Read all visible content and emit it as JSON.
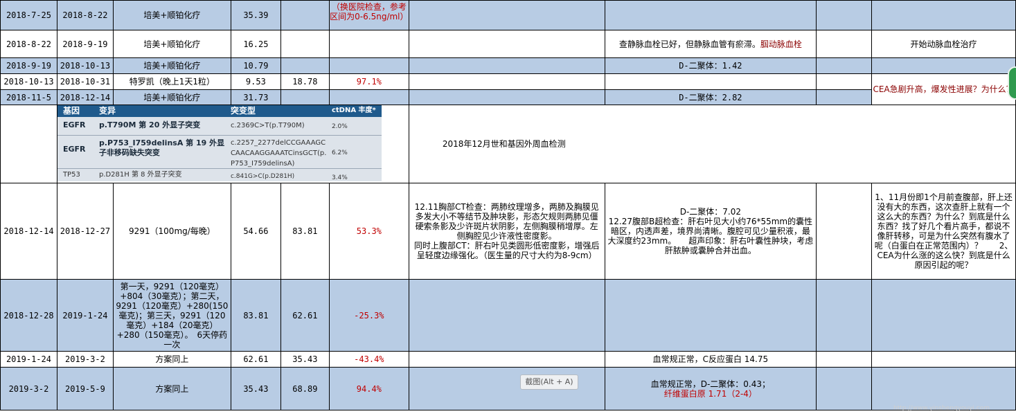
{
  "rows": [
    {
      "start": "2018-7-25",
      "end": "2018-8-22",
      "plan": "培美+顺铂化疗",
      "cea_before": "35.39",
      "cea_after": "",
      "change": "（换医院检查，参考区间为0-6.5ng/ml）",
      "ct": "",
      "other": "",
      "notes": ""
    },
    {
      "start": "2018-8-22",
      "end": "2018-9-19",
      "plan": "培美+顺铂化疗",
      "cea_before": "16.25",
      "cea_after": "",
      "change": "",
      "ct": "",
      "other_plain": "查静脉血栓已好，但静脉血管有瘀滞。",
      "other_red": "腘动脉血栓",
      "notes": "开始动脉血栓治疗"
    },
    {
      "start": "2018-9-19",
      "end": "2018-10-13",
      "plan": "培美+顺铂化疗",
      "cea_before": "10.79",
      "cea_after": "",
      "change": "",
      "ct": "",
      "other": "D-二聚体：1.42",
      "notes": ""
    },
    {
      "start": "2018-10-13",
      "end": "2018-10-31",
      "plan": "特罗凯（晚上1天1粒）",
      "cea_before": "9.53",
      "cea_after": "18.78",
      "change": "97.1%",
      "ct": "",
      "other": "",
      "notes": "CEA急剧升高，爆发性进展？为什么？"
    },
    {
      "start": "2018-11-5",
      "end": "2018-12-14",
      "plan": "培美+顺铂化疗",
      "cea_before": "31.73",
      "cea_after": "",
      "change": "",
      "ct": "",
      "other": "D-二聚体：2.82",
      "notes": ""
    },
    {
      "start": "2018-12-14",
      "end": "2018-12-27",
      "plan": "9291（100mg/每晚）",
      "cea_before": "54.66",
      "cea_after": "83.81",
      "change": "53.3%",
      "ct": "12.11胸部CT检查：两肺纹理增多，两肺及胸膜见多发大小不等结节及肿块影，形态欠规则两肺见僵硬索条影及少许斑片状阴影，左侧胸膜稍增厚。左侧胸腔见少许液性密度影。\n同时上腹部CT：肝右叶见类圆形低密度影，增强后呈轻度边缘强化。（医生量的尺寸大约为8-9cm）",
      "other": "D-二聚体：7.02\n12.27腹部B超检查：肝右叶见大小约76*55mm的囊性暗区，内透声差，境界尚清晰。腹腔可见少量积液，最大深度约23mm。　　超声印象：肝右叶囊性肿块，考虑肝脓肿或囊肿合并出血。",
      "notes": "1、11月份即1个月前查腹部，肝上还没有大的东西，这次查肝上就有一个这么大的东西？为什么？到底是什么东西？找了好几个看片高手，都说不像肝转移，可是为什么突然有腹水了呢（白蛋白在正常范围内）？　　2、CEA为什么涨的这么快？到底是什么原因引起的呢？"
    },
    {
      "start": "2018-12-28",
      "end": "2019-1-24",
      "plan": "第一天，9291（120毫克）+804（30毫克）；第二天，9291（120毫克）+280(150毫克)；第三天，9291（120毫克）+184（20毫克）+280（150毫克）。　6天停药一次",
      "cea_before": "83.81",
      "cea_after": "62.61",
      "change": "-25.3%",
      "ct": "",
      "other": "",
      "notes": ""
    },
    {
      "start": "2019-1-24",
      "end": "2019-3-2",
      "plan": "方案同上",
      "cea_before": "62.61",
      "cea_after": "35.43",
      "change": "-43.4%",
      "ct": "",
      "other": "血常规正常，C反应蛋白 14.75",
      "notes": ""
    },
    {
      "start": "2019-3-2",
      "end": "2019-5-9",
      "plan": "方案同上",
      "cea_before": "35.43",
      "cea_after": "68.89",
      "change": "94.4%",
      "ct": "",
      "other_plain": "血常规正常，D-二聚体：0.43；",
      "other_red": "纤维蛋白原 1.71（2-4）",
      "notes": ""
    }
  ],
  "genetic_test_label": "2018年12月世和基因外周血检测",
  "genetic_image": {
    "headers": [
      "基因",
      "变异",
      "突变型",
      "ctDNA 丰度*"
    ],
    "rows": [
      {
        "gene": "EGFR",
        "variant": "p.T790M 第 20 外显子突变",
        "mutation": "c.2369C>T(p.T790M)",
        "abundance": "2.0%"
      },
      {
        "gene": "EGFR",
        "variant": "p.P753_I759delinsA 第 19 外显子非移码缺失突变",
        "mutation": "c.2257_2277delCCGAAAGCCAACAAGGAAATCinsGCT(p.P753_I759delinsA)",
        "abundance": "6.2%"
      },
      {
        "gene": "TP53",
        "variant": "p.D281H 第 8 外显子突变",
        "mutation": "c.841G>C(p.D281H)",
        "abundance": "3.4%"
      }
    ]
  },
  "snip_tooltip": "截图(Alt + A)",
  "watermark": "http://www.yinshengyouyi.com",
  "colors": {
    "row_blue": "#b8cce4",
    "red": "#c00000",
    "dark_red": "#8b0000"
  }
}
